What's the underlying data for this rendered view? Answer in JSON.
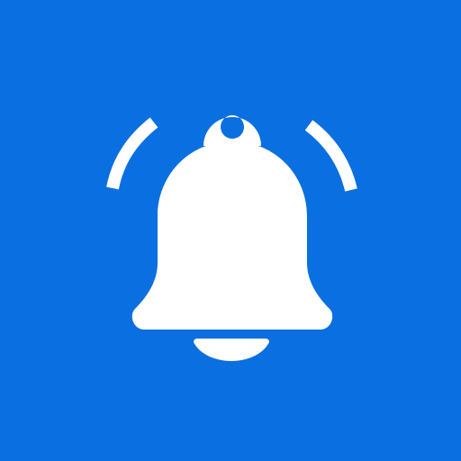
{
  "app_icon": {
    "icon": "notification-bell-icon",
    "colors": {
      "background": "#0A6FE0",
      "glyph": "#FFFFFF"
    }
  }
}
